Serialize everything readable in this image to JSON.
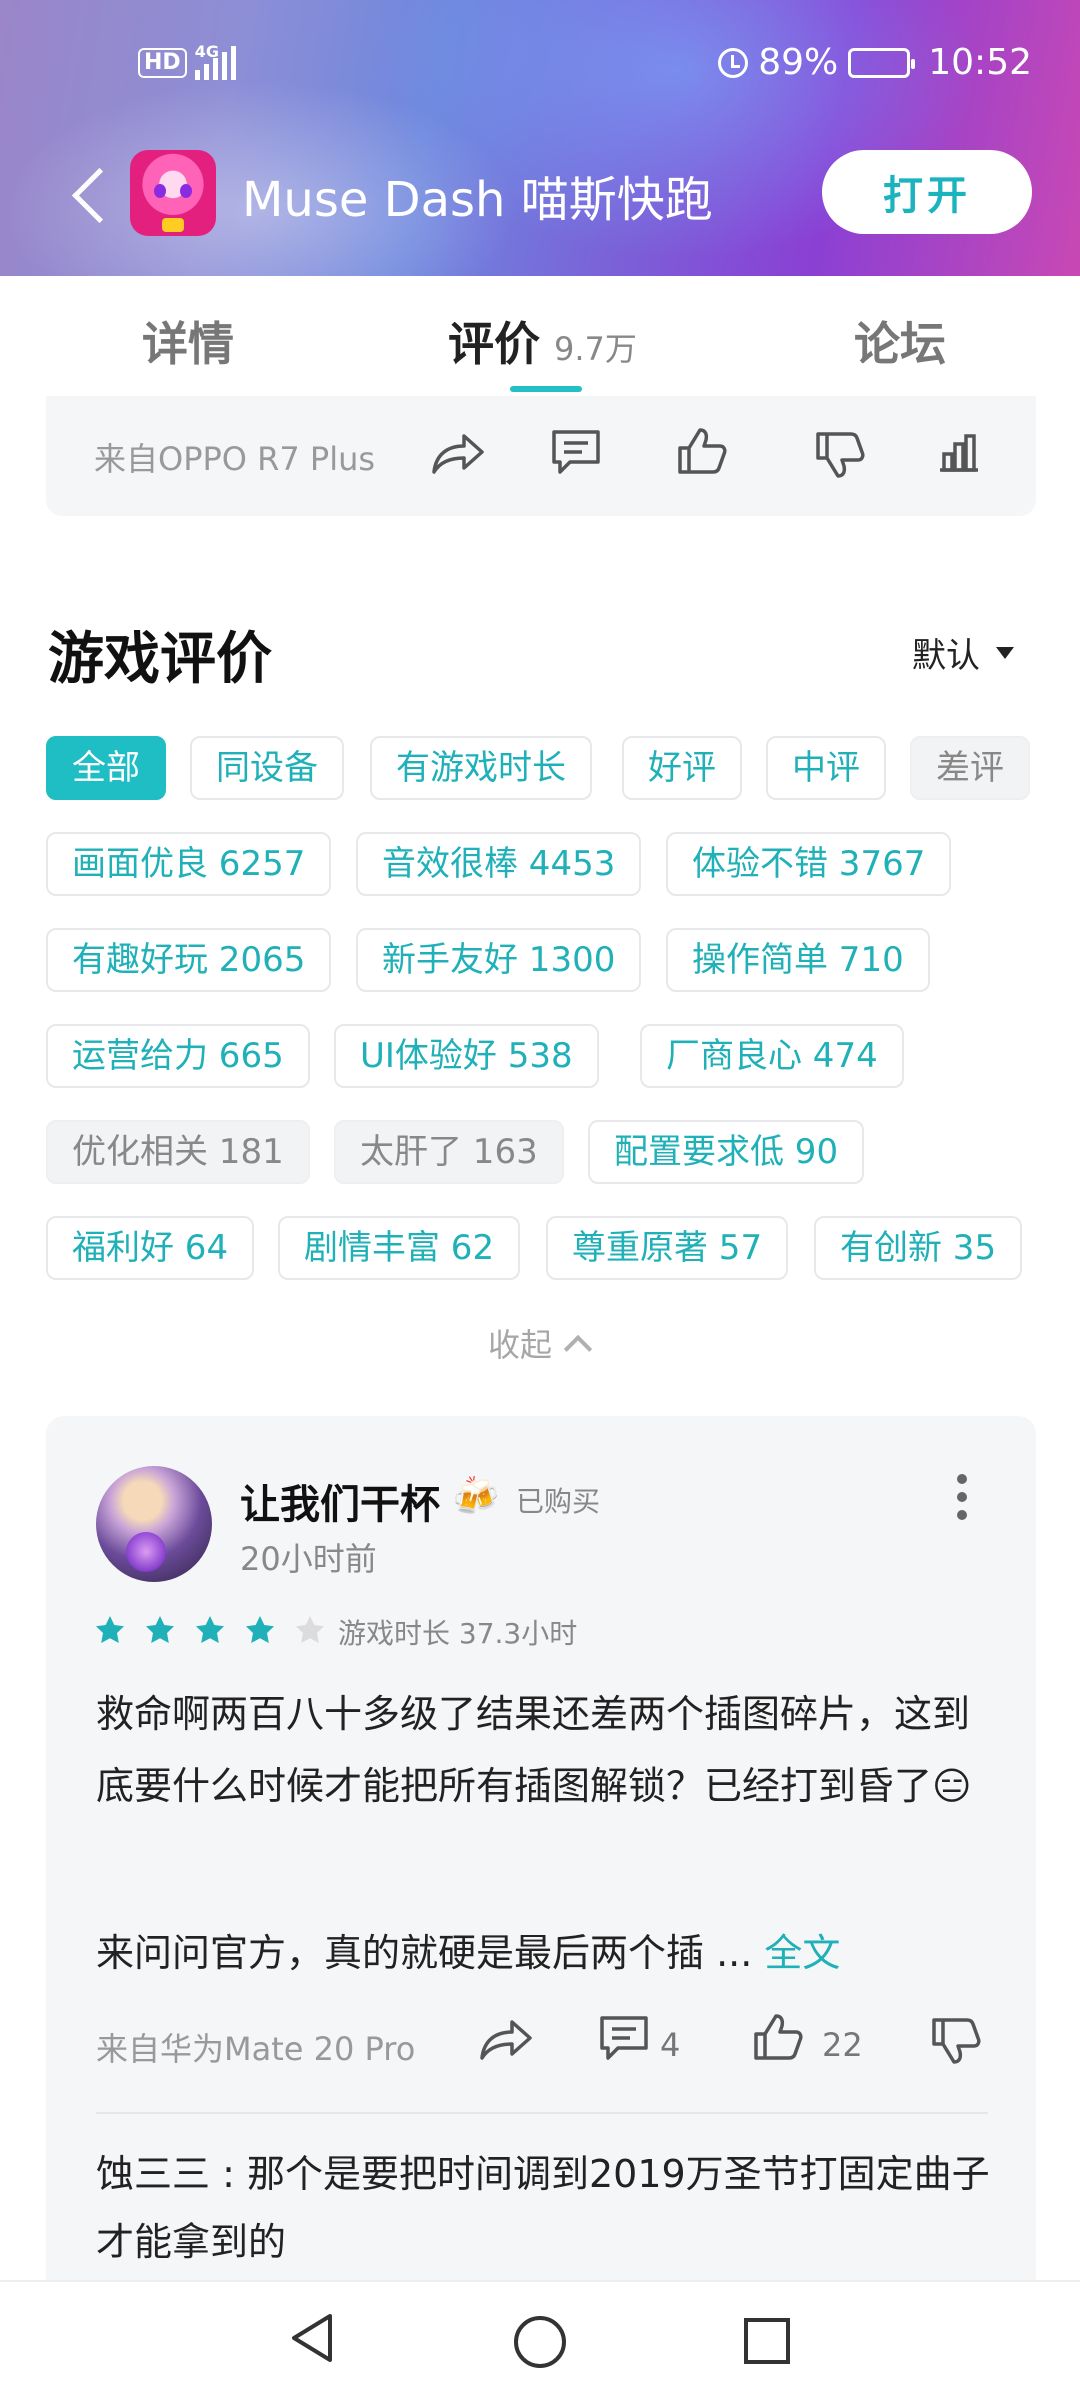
{
  "status_bar": {
    "hd": "HD",
    "network": "4G",
    "battery": "89%",
    "time": "10:52"
  },
  "app_bar": {
    "title": "Muse Dash 喵斯快跑",
    "open_label": "打开"
  },
  "tabs": [
    {
      "label": "详情"
    },
    {
      "label": "评价",
      "count": "9.7万"
    },
    {
      "label": "论坛"
    }
  ],
  "prev_card": {
    "source": "来自OPPO R7 Plus"
  },
  "section": {
    "title": "游戏评价",
    "sort_label": "默认"
  },
  "filters": [
    {
      "label": "全部",
      "style": "active"
    },
    {
      "label": "同设备",
      "style": "normal"
    },
    {
      "label": "有游戏时长",
      "style": "normal"
    },
    {
      "label": "好评",
      "style": "normal"
    },
    {
      "label": "中评",
      "style": "normal"
    },
    {
      "label": "差评",
      "style": "gray"
    }
  ],
  "tags": [
    {
      "label": "画面优良 6257",
      "style": "normal"
    },
    {
      "label": "音效很棒 4453",
      "style": "normal"
    },
    {
      "label": "体验不错 3767",
      "style": "normal"
    },
    {
      "label": "有趣好玩 2065",
      "style": "normal"
    },
    {
      "label": "新手友好 1300",
      "style": "normal"
    },
    {
      "label": "操作简单 710",
      "style": "normal"
    },
    {
      "label": "运营给力 665",
      "style": "normal"
    },
    {
      "label": "UI体验好  538",
      "style": "normal"
    },
    {
      "label": "厂商良心 474",
      "style": "normal"
    },
    {
      "label": "优化相关 181",
      "style": "gray"
    },
    {
      "label": "太肝了 163",
      "style": "gray"
    },
    {
      "label": "配置要求低 90",
      "style": "normal"
    },
    {
      "label": "福利好 64",
      "style": "normal"
    },
    {
      "label": "剧情丰富 62",
      "style": "normal"
    },
    {
      "label": "尊重原著 57",
      "style": "normal"
    },
    {
      "label": "有创新 35",
      "style": "normal"
    }
  ],
  "collapse_label": "收起",
  "review": {
    "username": "让我们干杯",
    "badge_emoji": "🍻",
    "purchased": "已购买",
    "time": "20小时前",
    "rating": 4,
    "rating_max": 5,
    "playtime": "游戏时长 37.3小时",
    "text": "救命啊两百八十多级了结果还差两个插图碎片，这到底要什么时候才能把所有插图解锁？已经打到昏了😑",
    "text_more": "来问问官方，真的就硬是最后两个插 ...",
    "full_text_label": "全文",
    "source": "来自华为Mate 20 Pro",
    "comment_count": "4",
    "like_count": "22",
    "reply": "蚀三三 : 那个是要把时间调到2019万圣节打固定曲子才能拿到的"
  },
  "colors": {
    "accent": "#1fbdc4",
    "star": "#1fb0b8"
  }
}
